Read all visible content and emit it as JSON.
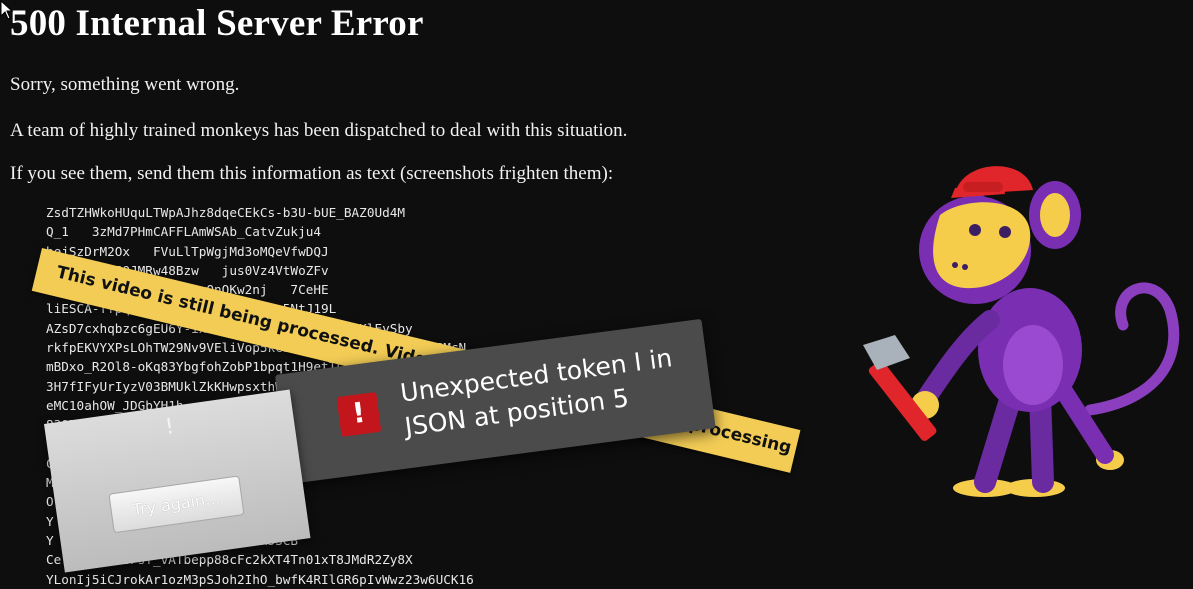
{
  "page": {
    "title": "500 Internal Server Error",
    "line1": "Sorry, something went wrong.",
    "line2": "A team of highly trained monkeys has been dispatched to deal with this situation.",
    "line3": "If you see them, send them this information as text (screenshots frighten them):"
  },
  "debug_lines": [
    "ZsdTZHWkoHUquLTWpAJhz8dqeCEkCs-b3U-bUE_BAZ0Ud4M",
    "Q_1   3zMd7PHmCAFFLAmWSAb_CatvZukju4",
    "bejSzDrM2Ox   FVuLlTpWgjMd3oMQeVfwDQJ",
    "EhuPLnm8bJQJMRw48Bzw   jus0Vz4VtWoZFv",
    "G-1R1KvmTv7hfoDNKGBnwOnQKw2nj   7CeHE",
    "liESCA-ffpqxRlN1eokPn3Uw2dInDHv5NtJ19L",
    "AZsD7cxhqbzc6gEU6Y-ixvSvXm9fKSnIwW1FadfsHKlEySby",
    "rkfpEKVYXPsLOhTW29Nv9VEliVop5kC3FhvoNKIzb0Dnj88Ps_JSMcN",
    "mBDxo_R2Ol8-oKq83YbgfohZobP1bpqt1H9etTLlgOv0",
    "3H7fIFyUrIyzV03BMUklZkKHwpsxthWR",
    "eMC10ahOW_JDGbYH1h",
    "830DU",
    "",
    "C",
    "M",
    "O   qWNq",
    "Y   7b41Ozr8JBcc29V0H",
    "Y   Dnja11MrHR1BV6XfUVl78C6ek53CB",
    "Ce   hb1U2SFsf_vATbepp88cFc2kXT4Tn01xT8JMdR2Zy8X",
    "YLonIj5iCJrokAr1ozM3pSJoh2IhO_bwfK4RIlGR6pIvWwz23w6UCK16"
  ],
  "banner": {
    "text": "This video is still being processed. Video quality may improve once processing"
  },
  "toast": {
    "icon_glyph": "!",
    "message": "Unexpected token I in JSON at position 5"
  },
  "panel": {
    "icon_glyph": "!",
    "button_label": "Try again..."
  },
  "icons": {
    "cursor": "mouse-pointer-icon",
    "error": "error-icon",
    "mascot": "monkey-with-hammer"
  },
  "colors": {
    "background": "#0e0e0e",
    "banner": "#f2cc55",
    "toast": "#4b4b4b",
    "error_red": "#c3161c",
    "monkey_purple": "#7a2fb3",
    "monkey_face": "#f6cd4a",
    "cap_red": "#e0262a"
  }
}
